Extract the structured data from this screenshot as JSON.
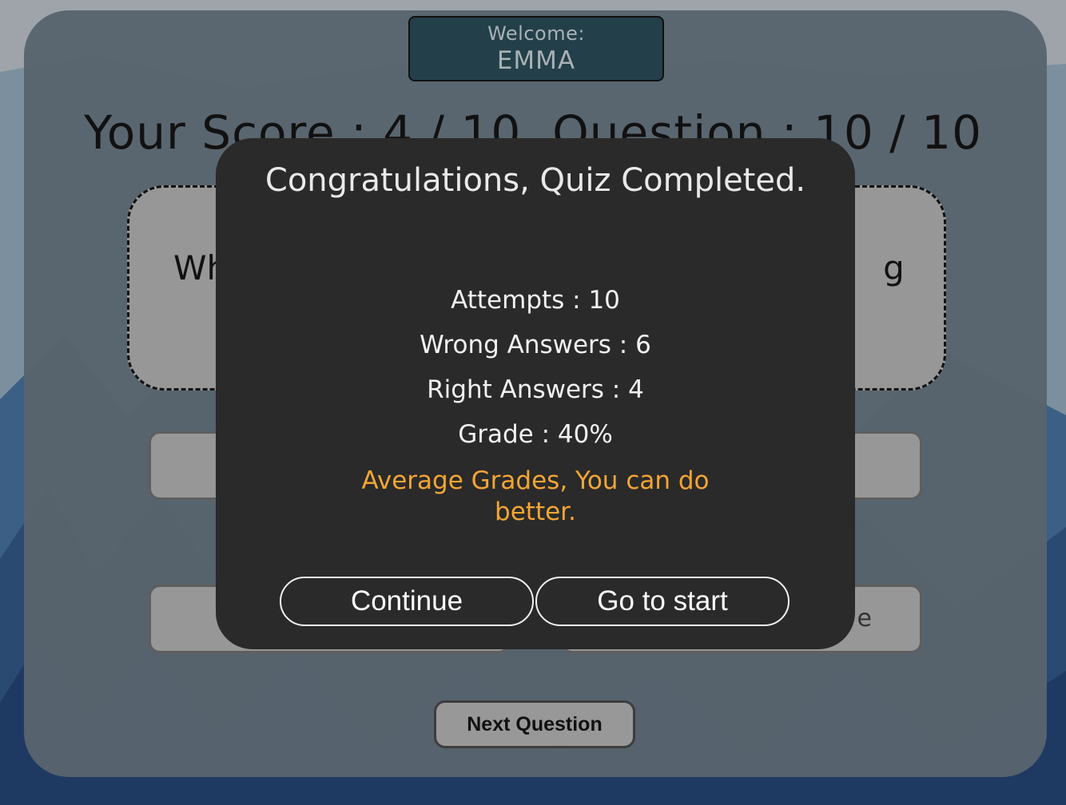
{
  "header": {
    "welcome_label": "Welcome:",
    "user_name": "EMMA"
  },
  "score": {
    "line": "Your Score : 4 / 10, Question : 10 / 10"
  },
  "question": {
    "text_start": "Wh",
    "text_end": "g a"
  },
  "options": [
    {
      "label": ""
    },
    {
      "label": ""
    },
    {
      "label": ""
    },
    {
      "label": "e"
    }
  ],
  "next_button_label": "Next Question",
  "modal": {
    "title": "Congratulations, Quiz Completed.",
    "attempts": "Attempts : 10",
    "wrong": "Wrong Answers : 6",
    "right": "Right Answers : 4",
    "grade": "Grade : 40%",
    "message": "Average Grades, You can do better.",
    "continue_label": "Continue",
    "start_label": "Go to start"
  },
  "colors": {
    "modal_bg": "#2a2a2a",
    "message": "#f3a535",
    "welcome_bg": "#233f4a"
  }
}
